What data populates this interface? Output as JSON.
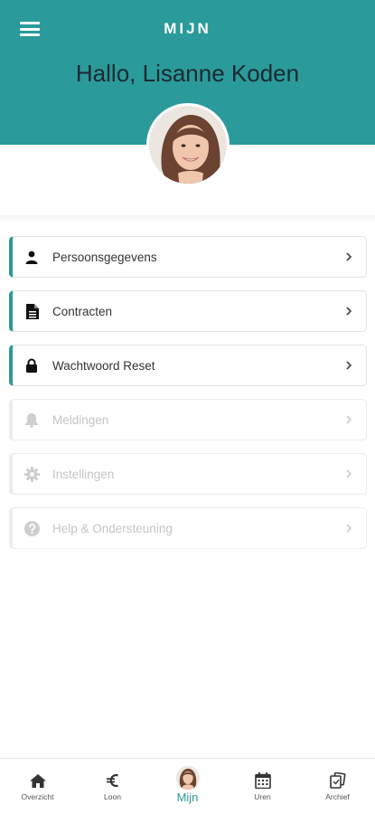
{
  "header": {
    "title": "MIJN",
    "greeting": "Hallo, Lisanne Koden",
    "menu_icon": "hamburger-menu-icon",
    "background_color": "#2a9a9a"
  },
  "menu": {
    "items": [
      {
        "label": "Persoonsgegevens",
        "icon": "person-icon",
        "enabled": true
      },
      {
        "label": "Contracten",
        "icon": "document-icon",
        "enabled": true
      },
      {
        "label": "Wachtwoord Reset",
        "icon": "lock-icon",
        "enabled": true
      },
      {
        "label": "Meldingen",
        "icon": "bell-icon",
        "enabled": false
      },
      {
        "label": "Instellingen",
        "icon": "gear-icon",
        "enabled": false
      },
      {
        "label": "Help & Ondersteuning",
        "icon": "question-circle-icon",
        "enabled": false
      }
    ]
  },
  "bottom_nav": {
    "items": [
      {
        "label": "Overzicht",
        "icon": "home-icon"
      },
      {
        "label": "Loon",
        "icon": "euro-icon"
      },
      {
        "label": "Mijn",
        "icon": "avatar-icon",
        "active": true
      },
      {
        "label": "Uren",
        "icon": "calendar-icon"
      },
      {
        "label": "Archief",
        "icon": "archive-icon"
      }
    ]
  }
}
